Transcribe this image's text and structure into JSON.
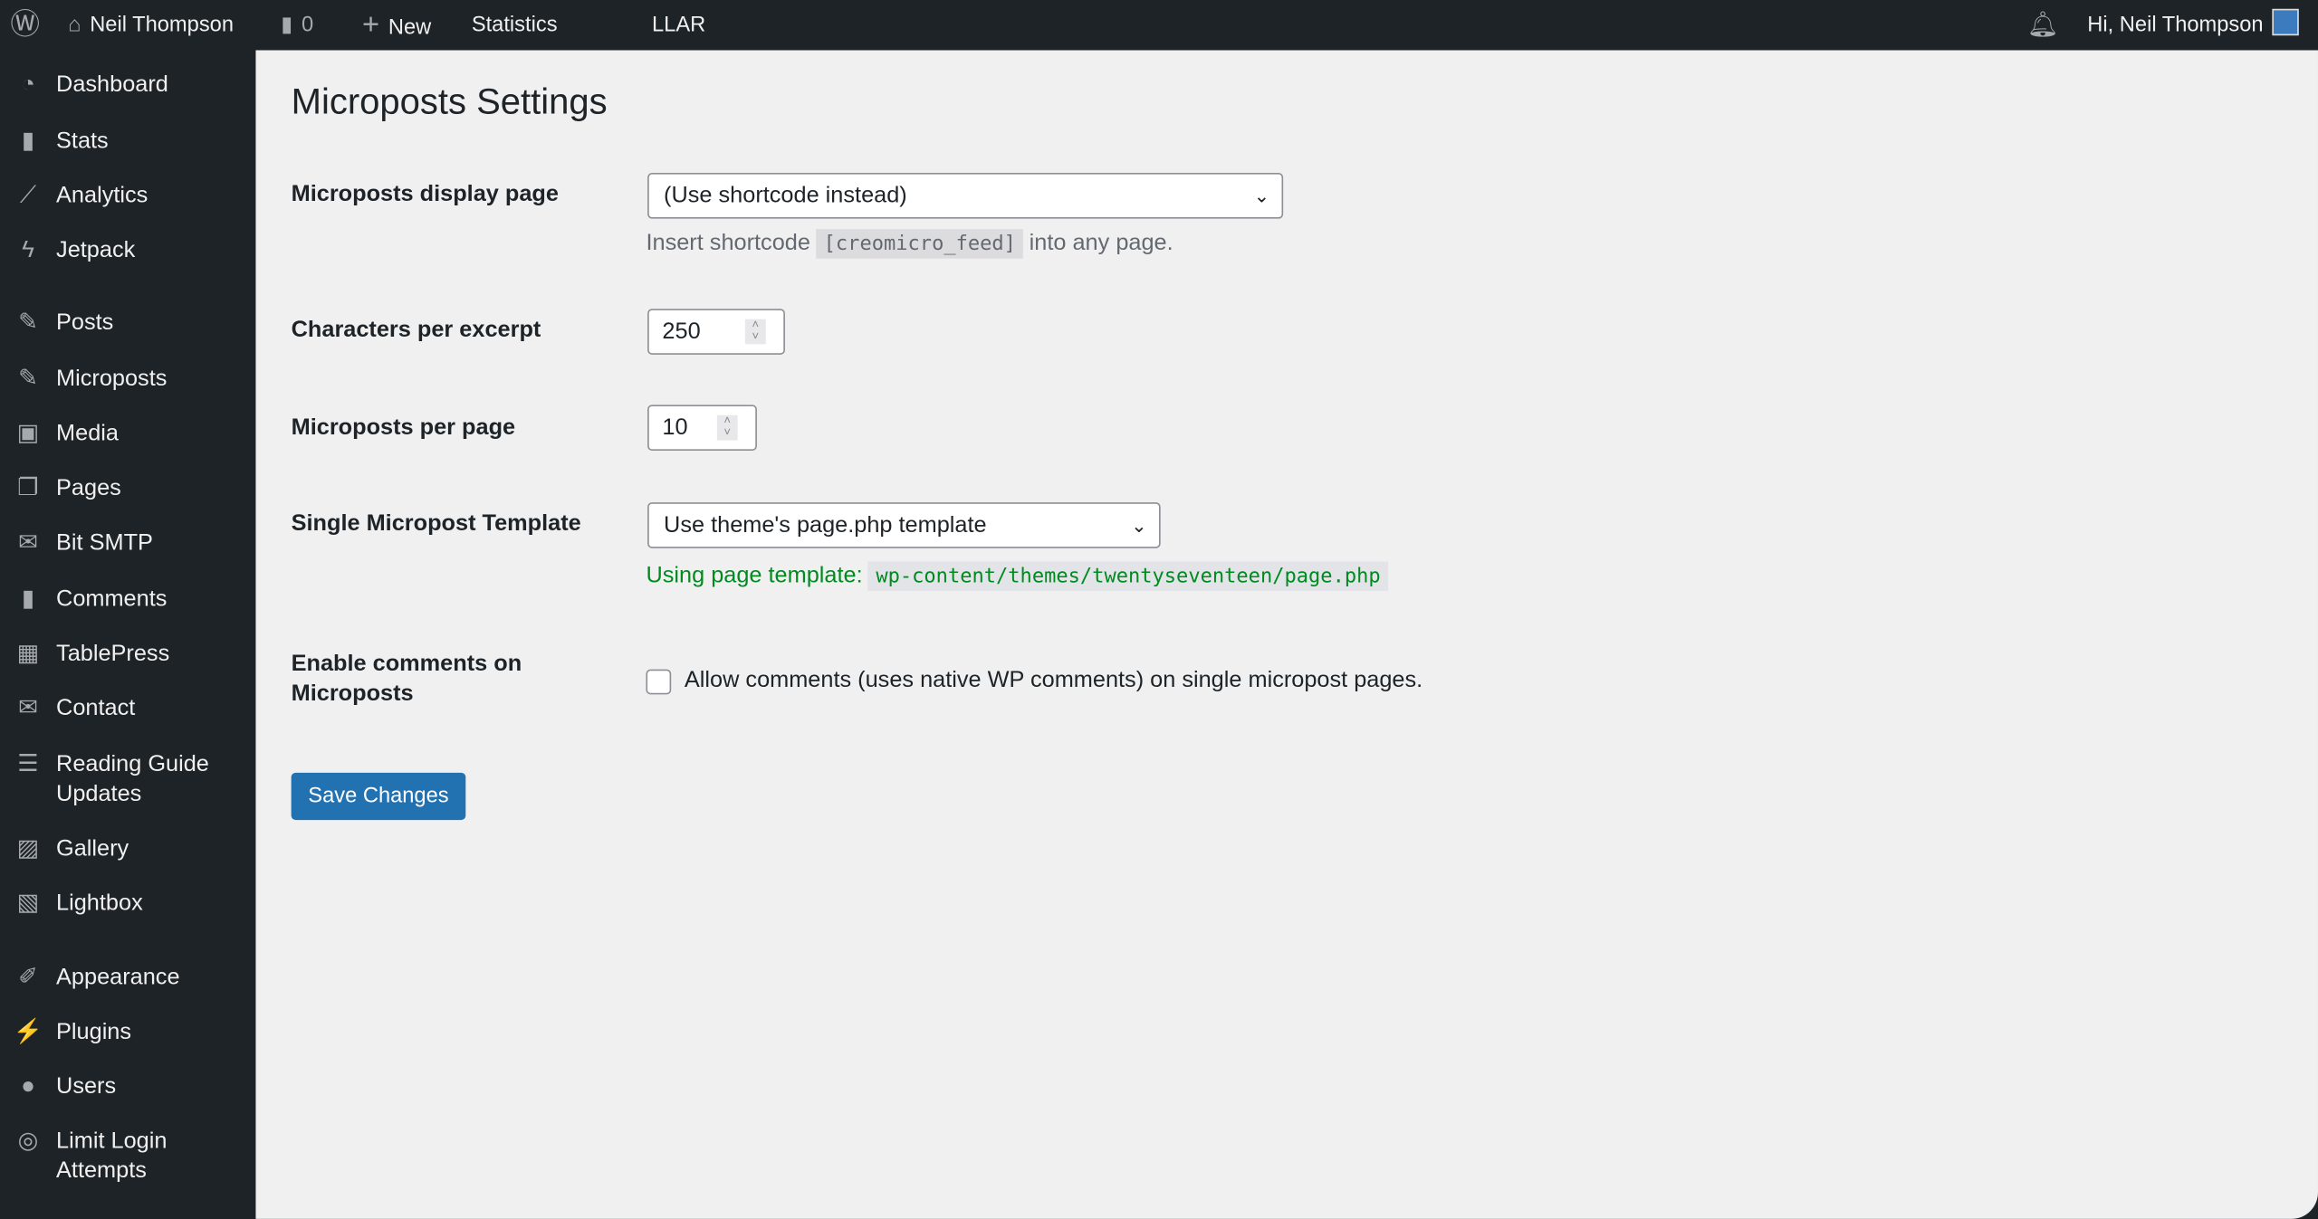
{
  "topbar": {
    "site": "Neil Thompson",
    "comments": "0",
    "new": "New",
    "statistics": "Statistics",
    "llar": "LLAR",
    "greeting": "Hi, Neil Thompson"
  },
  "sidebar": {
    "items": [
      {
        "label": "Dashboard",
        "icon": "dashboard-icon"
      },
      {
        "label": "Stats",
        "icon": "bar-chart-icon"
      },
      {
        "label": "Analytics",
        "icon": "line-chart-icon"
      },
      {
        "label": "Jetpack",
        "icon": "jetpack-icon"
      },
      {
        "label": "Posts",
        "icon": "pin-icon"
      },
      {
        "label": "Microposts",
        "icon": "pin-icon"
      },
      {
        "label": "Media",
        "icon": "media-icon"
      },
      {
        "label": "Pages",
        "icon": "pages-icon"
      },
      {
        "label": "Bit SMTP",
        "icon": "mail-icon"
      },
      {
        "label": "Comments",
        "icon": "comment-icon"
      },
      {
        "label": "TablePress",
        "icon": "table-icon"
      },
      {
        "label": "Contact",
        "icon": "envelope-icon"
      },
      {
        "label": "Reading Guide Updates",
        "icon": "list-icon"
      },
      {
        "label": "Gallery",
        "icon": "gallery-icon"
      },
      {
        "label": "Lightbox",
        "icon": "image-icon"
      },
      {
        "label": "Appearance",
        "icon": "brush-icon"
      },
      {
        "label": "Plugins",
        "icon": "plug-icon"
      },
      {
        "label": "Users",
        "icon": "user-icon"
      },
      {
        "label": "Limit Login Attempts",
        "icon": "fingerprint-icon"
      }
    ]
  },
  "main": {
    "title": "Microposts Settings",
    "display_page": {
      "label": "Microposts display page",
      "value": "(Use shortcode instead)",
      "help_pre": "Insert shortcode",
      "help_code": "[creomicro_feed]",
      "help_post": "into any page."
    },
    "chars": {
      "label": "Characters per excerpt",
      "value": "250"
    },
    "per_page": {
      "label": "Microposts per page",
      "value": "10"
    },
    "template": {
      "label": "Single Micropost Template",
      "value": "Use theme's page.php template",
      "help_pre": "Using page template:",
      "help_code": "wp-content/themes/twentyseventeen/page.php"
    },
    "comments": {
      "label": "Enable comments on Microposts",
      "checkbox_label": "Allow comments (uses native WP comments) on single micropost pages.",
      "checked": false
    },
    "save": "Save Changes"
  },
  "colors": {
    "accent": "#2271b1",
    "success": "#008a20",
    "sidebar": "#1d2327"
  }
}
